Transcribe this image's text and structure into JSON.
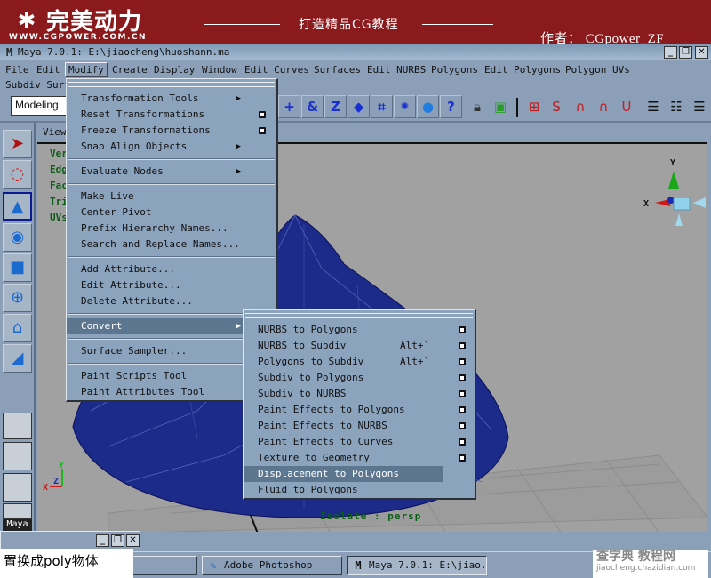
{
  "banner": {
    "logo_text": "完美动力",
    "logo_url": "WWW.CGPOWER.COM.CN",
    "slogan": "打造精品CG教程",
    "author": "作者： CGpower_ZF",
    "bg_color": "#8b1a1c"
  },
  "window": {
    "title": "Maya 7.0.1: E:\\jiaocheng\\huoshann.ma",
    "app_icon": "M",
    "controls": {
      "minimize": "_",
      "restore": "❐",
      "close": "✕"
    }
  },
  "menubar": {
    "items": [
      "File",
      "Edit",
      "Modify",
      "Create",
      "Display",
      "Window",
      "Edit Curves",
      "Surfaces",
      "Edit NURBS",
      "Polygons",
      "Edit Polygons",
      "Polygon UVs"
    ],
    "row2": [
      "Subdiv Surf"
    ],
    "active": "Modify"
  },
  "toolbar": {
    "mode": "Modeling",
    "shelf_icons": [
      "plus-icon",
      "snap-curve-icon",
      "snap-point-icon",
      "snap-surface-icon",
      "snap-grid-icon",
      "light-icon",
      "sphere-icon",
      "help-icon"
    ],
    "right_icons": [
      "lock-icon",
      "select-box-icon",
      "magnet-grid-icon",
      "magnet-curve-icon",
      "magnet-point-icon",
      "magnet-surface-icon",
      "magnet-icon",
      "channel-box-icon",
      "attribute-editor-icon",
      "tool-settings-icon"
    ]
  },
  "toolbox": {
    "tools": [
      "select-tool",
      "lasso-tool",
      "move-tool",
      "rotate-tool",
      "scale-tool",
      "universal-manipulator",
      "soft-mod-tool",
      "show-manipulator-tool"
    ],
    "selected": "move-tool"
  },
  "viewport": {
    "panel_menu": "View",
    "hud": [
      "Verts",
      "Edges",
      "Faces",
      "Tris",
      "UVs"
    ],
    "isolate_label": "Isolate : persp",
    "axis_labels": {
      "x": "X",
      "y": "Y",
      "z": "Z"
    }
  },
  "modify_menu": {
    "groups": [
      [
        {
          "label": "Transformation Tools",
          "submenu": true
        },
        {
          "label": "Reset Transformations",
          "option": true
        },
        {
          "label": "Freeze Transformations",
          "option": true
        },
        {
          "label": "Snap Align Objects",
          "submenu": true
        }
      ],
      [
        {
          "label": "Evaluate Nodes",
          "submenu": true
        }
      ],
      [
        {
          "label": "Make Live"
        },
        {
          "label": "Center Pivot"
        },
        {
          "label": "Prefix Hierarchy Names..."
        },
        {
          "label": "Search and Replace Names..."
        }
      ],
      [
        {
          "label": "Add Attribute..."
        },
        {
          "label": "Edit Attribute..."
        },
        {
          "label": "Delete Attribute..."
        }
      ],
      [
        {
          "label": "Convert",
          "submenu": true,
          "highlighted": true
        }
      ],
      [
        {
          "label": "Surface Sampler..."
        }
      ],
      [
        {
          "label": "Paint Scripts Tool"
        },
        {
          "label": "Paint Attributes Tool"
        }
      ]
    ]
  },
  "convert_menu": {
    "items": [
      {
        "label": "NURBS to Polygons",
        "option": true
      },
      {
        "label": "NURBS to Subdiv",
        "shortcut": "Alt+`",
        "option": true
      },
      {
        "label": "Polygons to Subdiv",
        "shortcut": "Alt+`",
        "option": true
      },
      {
        "label": "Subdiv to Polygons",
        "option": true
      },
      {
        "label": "Subdiv to NURBS",
        "option": true
      },
      {
        "label": "Paint Effects to Polygons",
        "option": true
      },
      {
        "label": "Paint Effects to NURBS",
        "option": true
      },
      {
        "label": "Paint Effects to Curves",
        "option": true
      },
      {
        "label": "Texture to Geometry",
        "option": true
      },
      {
        "label": "Displacement to Polygons",
        "highlighted": true
      },
      {
        "label": "Fluid to Polygons"
      }
    ]
  },
  "caption": "置换成poly物体",
  "taskbar": {
    "tasks": [
      {
        "label": "",
        "icon": ""
      },
      {
        "label": "Adobe Photoshop",
        "icon": "photoshop-icon"
      },
      {
        "label": "Maya 7.0.1: E:\\jiao...",
        "icon": "maya-icon",
        "active": true
      }
    ]
  },
  "watermark": {
    "text": "查字典 教程网",
    "url": "jiaocheng.chazidian.com"
  }
}
